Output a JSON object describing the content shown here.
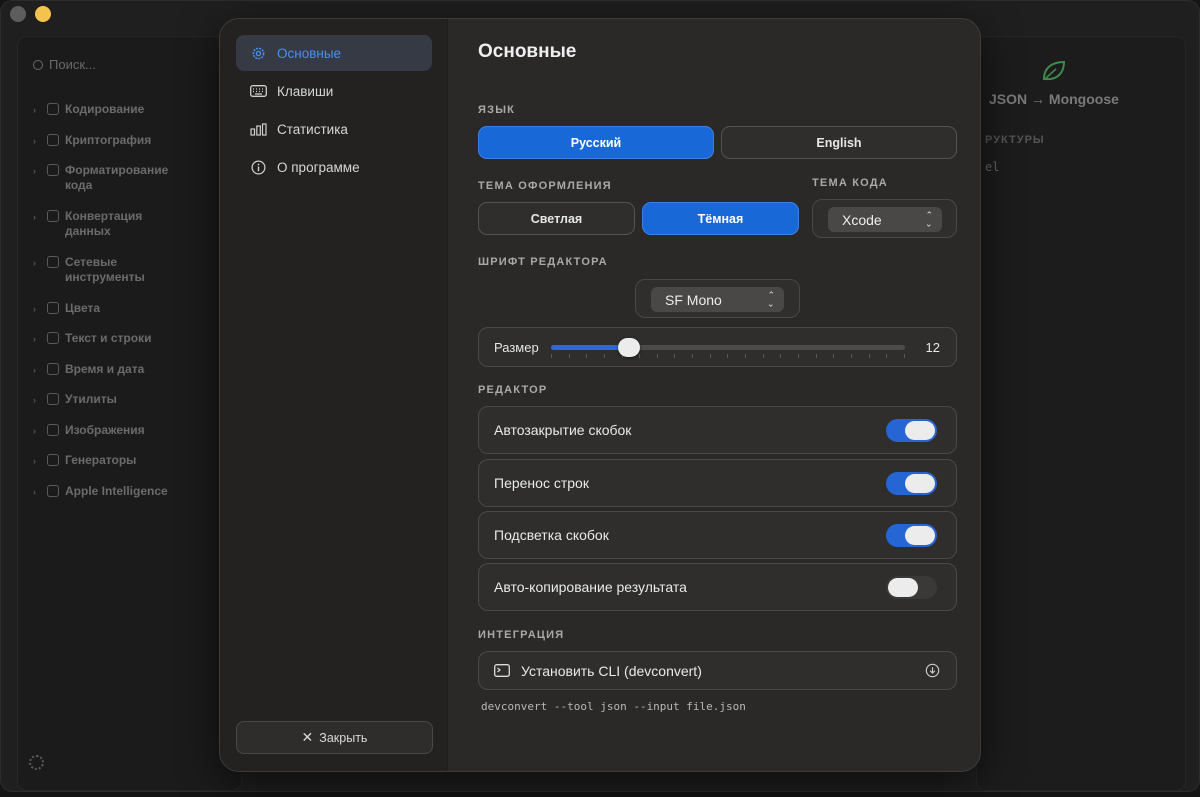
{
  "background": {
    "search_placeholder": "Поиск...",
    "sidebar_items": [
      {
        "label": "Кодирование"
      },
      {
        "label": "Криптография"
      },
      {
        "label": "Форматирование\nкода"
      },
      {
        "label": "Конвертация\nданных"
      },
      {
        "label": "Сетевые\nинструменты"
      },
      {
        "label": "Цвета"
      },
      {
        "label": "Текст и строки"
      },
      {
        "label": "Время и дата"
      },
      {
        "label": "Утилиты"
      },
      {
        "label": "Изображения"
      },
      {
        "label": "Генераторы"
      },
      {
        "label": "Apple Intelligence"
      }
    ],
    "right_title": "JSON → Mongoose",
    "right_section": "РУКТУРЫ",
    "right_code": "el"
  },
  "dialog": {
    "nav": [
      {
        "label": "Основные",
        "icon": "gear-icon",
        "active": true
      },
      {
        "label": "Клавиши",
        "icon": "keyboard-icon",
        "active": false
      },
      {
        "label": "Статистика",
        "icon": "chart-icon",
        "active": false
      },
      {
        "label": "О программе",
        "icon": "info-icon",
        "active": false
      }
    ],
    "close_label": "Закрыть",
    "title": "Основные",
    "language": {
      "section": "ЯЗЫК",
      "options": [
        "Русский",
        "English"
      ],
      "selected": "Русский"
    },
    "theme": {
      "section": "ТЕМА ОФОРМЛЕНИЯ",
      "options": [
        "Светлая",
        "Тёмная"
      ],
      "selected": "Тёмная"
    },
    "code_theme": {
      "section": "ТЕМА КОДА",
      "value": "Xcode"
    },
    "font": {
      "section": "ШРИФТ РЕДАКТОРА",
      "value": "SF Mono",
      "size_label": "Размер",
      "size_value": "12",
      "size_fraction": 0.22
    },
    "editor": {
      "section": "РЕДАКТОР",
      "toggles": [
        {
          "label": "Автозакрытие скобок",
          "on": true
        },
        {
          "label": "Перенос строк",
          "on": true
        },
        {
          "label": "Подсветка скобок",
          "on": true
        },
        {
          "label": "Авто-копирование результата",
          "on": false
        }
      ]
    },
    "integration": {
      "section": "ИНТЕГРАЦИЯ",
      "cli_label": "Установить CLI (devconvert)",
      "cli_command": "devconvert --tool json --input file.json"
    }
  },
  "colors": {
    "accent": "#1868d8",
    "active_nav_text": "#4c8ff3",
    "dialog_bg": "#2b2928"
  }
}
